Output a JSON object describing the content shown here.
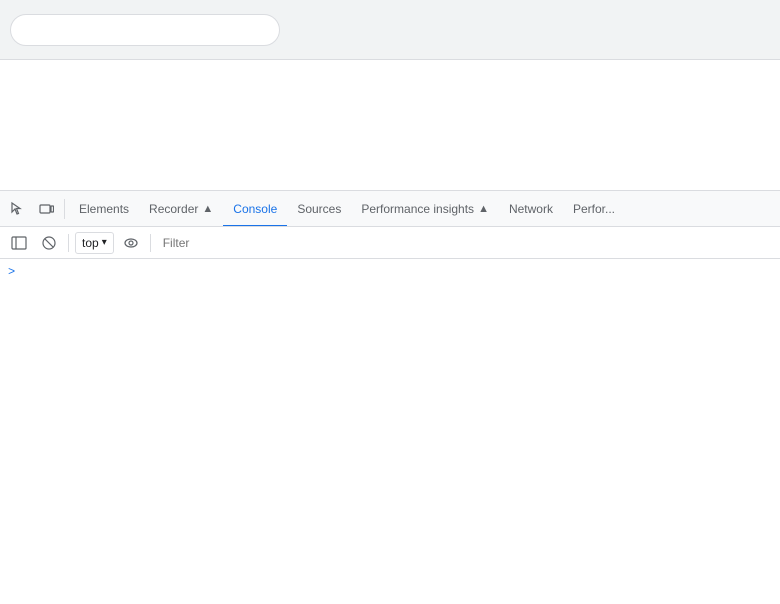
{
  "browser": {
    "address_bar_value": "",
    "address_bar_placeholder": ""
  },
  "devtools": {
    "tabs": [
      {
        "id": "elements",
        "label": "Elements",
        "active": false,
        "has_icon": false
      },
      {
        "id": "recorder",
        "label": "Recorder",
        "active": false,
        "has_icon": true
      },
      {
        "id": "console",
        "label": "Console",
        "active": true,
        "has_icon": false
      },
      {
        "id": "sources",
        "label": "Sources",
        "active": false,
        "has_icon": false
      },
      {
        "id": "performance-insights",
        "label": "Performance insights",
        "active": false,
        "has_icon": true
      },
      {
        "id": "network",
        "label": "Network",
        "active": false,
        "has_icon": false
      },
      {
        "id": "performance",
        "label": "Perfor...",
        "active": false,
        "has_icon": false
      }
    ],
    "toolbar": {
      "context": "top",
      "filter_placeholder": "Filter"
    },
    "icons": {
      "inspect": "⬡",
      "device": "▭",
      "clear": "⊘",
      "eye": "👁",
      "chevron": "▾"
    }
  },
  "console": {
    "prompt_symbol": ">"
  }
}
